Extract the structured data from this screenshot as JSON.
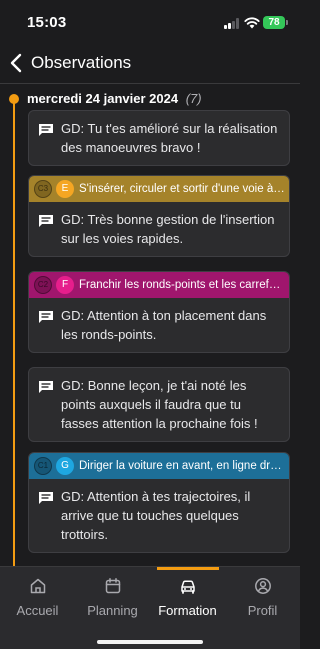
{
  "status_bar": {
    "time": "15:03",
    "battery": "78"
  },
  "header": {
    "title": "Observations",
    "back_icon": "chevron-left-icon"
  },
  "timeline": {
    "date": "mercredi 24 janvier 2024",
    "count": "(7)",
    "accent": "#f39c12"
  },
  "observations": [
    {
      "text": "GD: Tu t'es amélioré sur la réalisation des manoeuvres bravo !"
    },
    {
      "skill": {
        "code": "C3",
        "letter": "E",
        "title": "S'insérer, circuler et sortir d'une voie à caractère rapide.",
        "color": "#a5832a",
        "badge": "#f5a623"
      },
      "text": "GD: Très bonne gestion de l'insertion sur les voies rapides."
    },
    {
      "skill": {
        "code": "C2",
        "letter": "F",
        "title": "Franchir les ronds-points et les carrefours à sens giratoire.",
        "color": "#a0166d",
        "badge": "#e61e8c"
      },
      "text": "GD: Attention à ton placement dans les ronds-points."
    },
    {
      "text": "GD: Bonne leçon, je t'ai noté les points auxquels il faudra que tu fasses attention la prochaine fois !"
    },
    {
      "skill": {
        "code": "C1",
        "letter": "G",
        "title": "Diriger la voiture en avant, en ligne droite et en courbe.",
        "color": "#1d6f98",
        "badge": "#1ea7e1"
      },
      "text": "GD: Attention à tes trajectoires, il arrive que tu touches quelques trottoirs."
    }
  ],
  "tabs": [
    {
      "label": "Accueil",
      "icon": "home-icon",
      "active": false
    },
    {
      "label": "Planning",
      "icon": "calendar-icon",
      "active": false
    },
    {
      "label": "Formation",
      "icon": "car-icon",
      "active": true
    },
    {
      "label": "Profil",
      "icon": "profile-icon",
      "active": false
    }
  ]
}
